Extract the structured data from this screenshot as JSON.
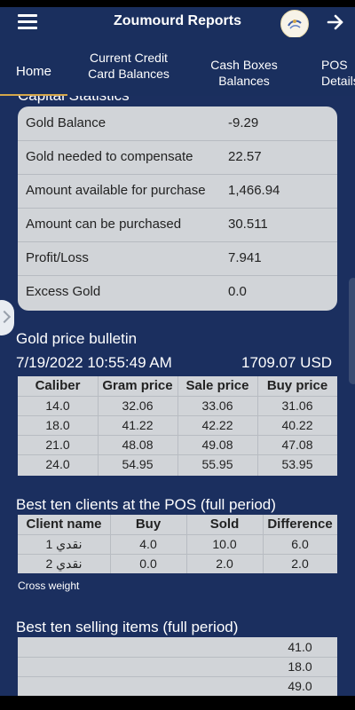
{
  "app": {
    "title": "Zoumourd Reports"
  },
  "tabs": [
    {
      "label": "Home"
    },
    {
      "label": "Current Credit Card Balances"
    },
    {
      "label": "Cash Boxes Balances"
    },
    {
      "label": "POS Details"
    }
  ],
  "capital": {
    "title": "Capital Statistics",
    "rows": [
      {
        "label": "Gold Balance",
        "value": "-9.29"
      },
      {
        "label": "Gold needed to compensate",
        "value": "22.57"
      },
      {
        "label": "Amount available for purchase",
        "value": "1,466.94"
      },
      {
        "label": "Amount can be purchased",
        "value": "30.511"
      },
      {
        "label": "Profit/Loss",
        "value": "7.941"
      },
      {
        "label": "Excess Gold",
        "value": "0.0"
      }
    ]
  },
  "bulletin": {
    "title": "Gold price bulletin",
    "datetime": "7/19/2022 10:55:49 AM",
    "usd": "1709.07 USD",
    "headers": [
      "Caliber",
      "Gram price",
      "Sale price",
      "Buy price"
    ],
    "rows": [
      [
        "14.0",
        "32.06",
        "33.06",
        "31.06"
      ],
      [
        "18.0",
        "41.22",
        "42.22",
        "40.22"
      ],
      [
        "21.0",
        "48.08",
        "49.08",
        "47.08"
      ],
      [
        "24.0",
        "54.95",
        "55.95",
        "53.95"
      ]
    ]
  },
  "clients": {
    "title": "Best ten clients at the POS (full period)",
    "headers": [
      "Client name",
      "Buy",
      "Sold",
      "Difference"
    ],
    "rows": [
      [
        "نقدي 1",
        "4.0",
        "10.0",
        "6.0"
      ],
      [
        "نقدي 2",
        "0.0",
        "2.0",
        "2.0"
      ]
    ],
    "note": "Cross weight"
  },
  "items": {
    "title": "Best ten selling items (full period)",
    "values": [
      "41.0",
      "18.0",
      "49.0"
    ]
  },
  "icons": {
    "menu": "hamburger-menu-icon",
    "logo": "brand-logo-icon",
    "forward": "arrow-right-icon"
  },
  "colors": {
    "navy": "#1b2f5f",
    "card": "#d1d4d8",
    "accent": "#d4a64a"
  }
}
